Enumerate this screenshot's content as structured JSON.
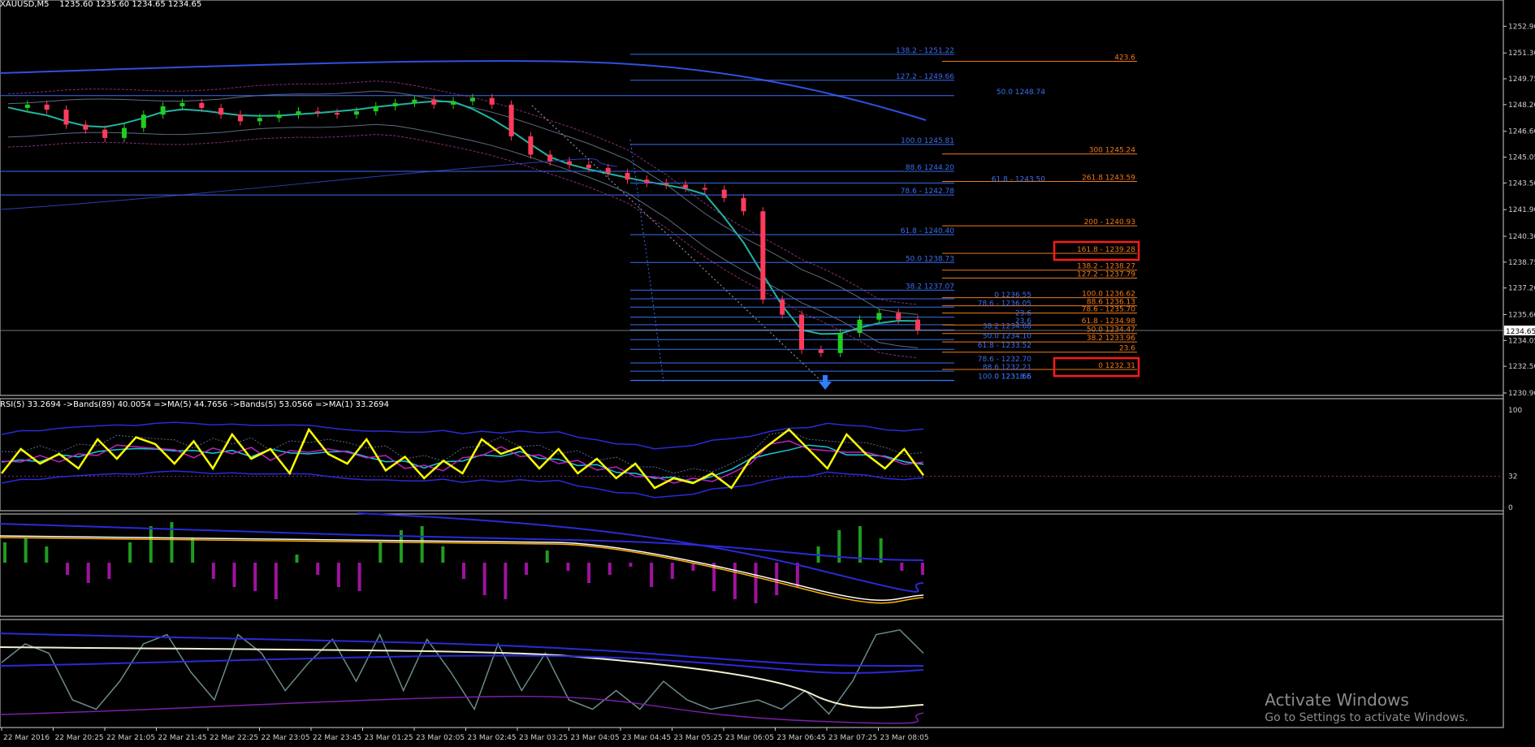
{
  "header": {
    "symbol": "XAUUSD,M5",
    "ohlc": "1235.60 1235.60 1234.65 1234.65"
  },
  "indicator_header": "RSI(5) 33.2694 ->Bands(89) 40.0054 =>MA(5) 44.7656 ->Bands(5) 53.0566 =>MA(1) 33.2694",
  "watermark": {
    "line1": "Activate Windows",
    "line2": "Go to Settings to activate Windows."
  },
  "colors": {
    "background": "#000000",
    "bull": "#22cc22",
    "bear": "#ff3b5c",
    "fib_blue": "#3a6ef0",
    "fib_orange": "#f07a1a",
    "highlight_box": "#ff1a1a",
    "ma_teal": "#1fb5a0",
    "rsi_yellow": "#ffff00",
    "hist_green": "#1f9c1f",
    "hist_purple": "#a0129e"
  },
  "chart_data": [
    {
      "type": "candlestick",
      "pane": "main",
      "symbol": "XAUUSD",
      "timeframe": "M5",
      "ylim": [
        1230.9,
        1253.6
      ],
      "y_ticks": [
        "1252.90",
        "1251.30",
        "1249.75",
        "1248.20",
        "1246.60",
        "1245.05",
        "1243.50",
        "1241.90",
        "1240.30",
        "1238.75",
        "1237.20",
        "1235.60",
        "1234.05",
        "1232.50",
        "1230.90"
      ],
      "current_price": "1234.65",
      "price_path": [
        1248.0,
        1248.2,
        1247.9,
        1247.0,
        1246.7,
        1246.2,
        1246.8,
        1247.6,
        1248.1,
        1248.3,
        1248.0,
        1247.6,
        1247.2,
        1247.4,
        1247.6,
        1247.8,
        1247.7,
        1247.6,
        1247.8,
        1248.1,
        1248.3,
        1248.5,
        1248.2,
        1248.4,
        1248.6,
        1248.2,
        1246.3,
        1245.2,
        1244.8,
        1244.6,
        1244.4,
        1244.1,
        1243.7,
        1243.5,
        1243.4,
        1243.2,
        1243.1,
        1242.6,
        1241.8,
        1236.5,
        1235.6,
        1233.5,
        1233.3,
        1234.5,
        1235.3,
        1235.7,
        1235.3,
        1234.65
      ],
      "fib_levels_blue": [
        {
          "label": "138.2 - 1251.22",
          "price": 1251.22
        },
        {
          "label": "127.2 - 1249.66",
          "price": 1249.66
        },
        {
          "label": "50.0 1248.74",
          "price": 1248.74
        },
        {
          "label": "100.0 1245.81",
          "price": 1245.81
        },
        {
          "label": "88.6 1244.20",
          "price": 1244.2
        },
        {
          "label": "61.8 - 1243.50",
          "price": 1243.5
        },
        {
          "label": "78.6 - 1242.78",
          "price": 1242.78
        },
        {
          "label": "61.8 - 1240.40",
          "price": 1240.4
        },
        {
          "label": "50.0 1238.73",
          "price": 1238.73
        },
        {
          "label": "38.2 1237.07",
          "price": 1237.07
        },
        {
          "label": "0 1236.55",
          "price": 1236.55
        },
        {
          "label": "78.6 - 1236.05",
          "price": 1236.05
        },
        {
          "label": "23.6",
          "price": 1235.45
        },
        {
          "label": "23.6",
          "price": 1235.0
        },
        {
          "label": "38.2 1234.68",
          "price": 1234.68
        },
        {
          "label": "50.0 1234.10",
          "price": 1234.1
        },
        {
          "label": "61.8 - 1233.52",
          "price": 1233.52
        },
        {
          "label": "78.6 - 1232.70",
          "price": 1232.7
        },
        {
          "label": "88.6 1232.21",
          "price": 1232.21
        },
        {
          "label": "0 1231.66",
          "price": 1231.66
        },
        {
          "label": "100.0 1231.65",
          "price": 1231.65
        },
        {
          "label": "8.6",
          "price": 1231.65
        }
      ],
      "fib_levels_orange": [
        {
          "label": "423.6",
          "price": 1250.8
        },
        {
          "label": "300 1245.24",
          "price": 1245.24
        },
        {
          "label": "261.8 1243.59",
          "price": 1243.59
        },
        {
          "label": "200 - 1240.93",
          "price": 1240.93
        },
        {
          "label": "161.8 - 1239.28",
          "price": 1239.28,
          "highlight": true
        },
        {
          "label": "138.2 - 1238.27",
          "price": 1238.27
        },
        {
          "label": "127.2 - 1237.79",
          "price": 1237.79
        },
        {
          "label": "100.0 1236.62",
          "price": 1236.62
        },
        {
          "label": "88.6 1236.13",
          "price": 1236.13
        },
        {
          "label": "78.6 - 1235.70",
          "price": 1235.7
        },
        {
          "label": "61.8 - 1234.98",
          "price": 1234.98
        },
        {
          "label": "50.0 1234.47",
          "price": 1234.47
        },
        {
          "label": "38.2 1233.96",
          "price": 1233.96
        },
        {
          "label": "23.6",
          "price": 1233.35
        },
        {
          "label": "0 1232.31",
          "price": 1232.31,
          "highlight": true
        }
      ],
      "time_labels": [
        "22 Mar 2016",
        "22 Mar 20:25",
        "22 Mar 21:05",
        "22 Mar 21:45",
        "22 Mar 22:25",
        "22 Mar 23:05",
        "22 Mar 23:45",
        "23 Mar 01:25",
        "23 Mar 02:05",
        "23 Mar 02:45",
        "23 Mar 03:25",
        "23 Mar 04:05",
        "23 Mar 04:45",
        "23 Mar 05:25",
        "23 Mar 06:05",
        "23 Mar 06:45",
        "23 Mar 07:25",
        "23 Mar 08:05"
      ]
    },
    {
      "type": "line",
      "pane": "rsi",
      "ylim": [
        0,
        100
      ],
      "y_ticks": [
        "100",
        "32",
        "0"
      ],
      "series": [
        {
          "name": "RSI(5)",
          "values": [
            35,
            60,
            45,
            55,
            40,
            70,
            50,
            72,
            65,
            45,
            68,
            40,
            75,
            50,
            60,
            35,
            80,
            55,
            45,
            70,
            38,
            52,
            30,
            48,
            35,
            70,
            55,
            62,
            40,
            60,
            35,
            50,
            30,
            45,
            20,
            30,
            25,
            35,
            20,
            50,
            65,
            80,
            60,
            40,
            75,
            55,
            40,
            60,
            33
          ]
        }
      ]
    },
    {
      "type": "bar",
      "pane": "macd",
      "values": [
        0.5,
        0.6,
        0.4,
        -0.3,
        -0.5,
        -0.4,
        0.5,
        0.9,
        1.0,
        0.6,
        -0.4,
        -0.6,
        -0.7,
        -0.9,
        0.2,
        -0.3,
        -0.6,
        -0.7,
        0.5,
        0.8,
        0.9,
        0.4,
        -0.4,
        -0.8,
        -0.9,
        -0.3,
        0.3,
        -0.2,
        -0.5,
        -0.3,
        -0.1,
        -0.6,
        -0.4,
        -0.2,
        -0.7,
        -0.9,
        -1.0,
        -0.8,
        -0.6,
        0.4,
        0.8,
        0.9,
        0.6,
        -0.2,
        -0.3
      ]
    },
    {
      "type": "line",
      "pane": "lower",
      "series": [
        {
          "name": "",
          "values": [
            0.6,
            0.8,
            0.7,
            0.2,
            0.1,
            0.4,
            0.8,
            0.9,
            0.5,
            0.2,
            0.9,
            0.7,
            0.3,
            0.6,
            0.85,
            0.4,
            0.9,
            0.3,
            0.85,
            0.5,
            0.1,
            0.8,
            0.3,
            0.7,
            0.2,
            0.1,
            0.3,
            0.1,
            0.4,
            0.2,
            0.1,
            0.15,
            0.2,
            0.1,
            0.3,
            0.05,
            0.4,
            0.9,
            0.95,
            0.7
          ]
        }
      ]
    }
  ]
}
